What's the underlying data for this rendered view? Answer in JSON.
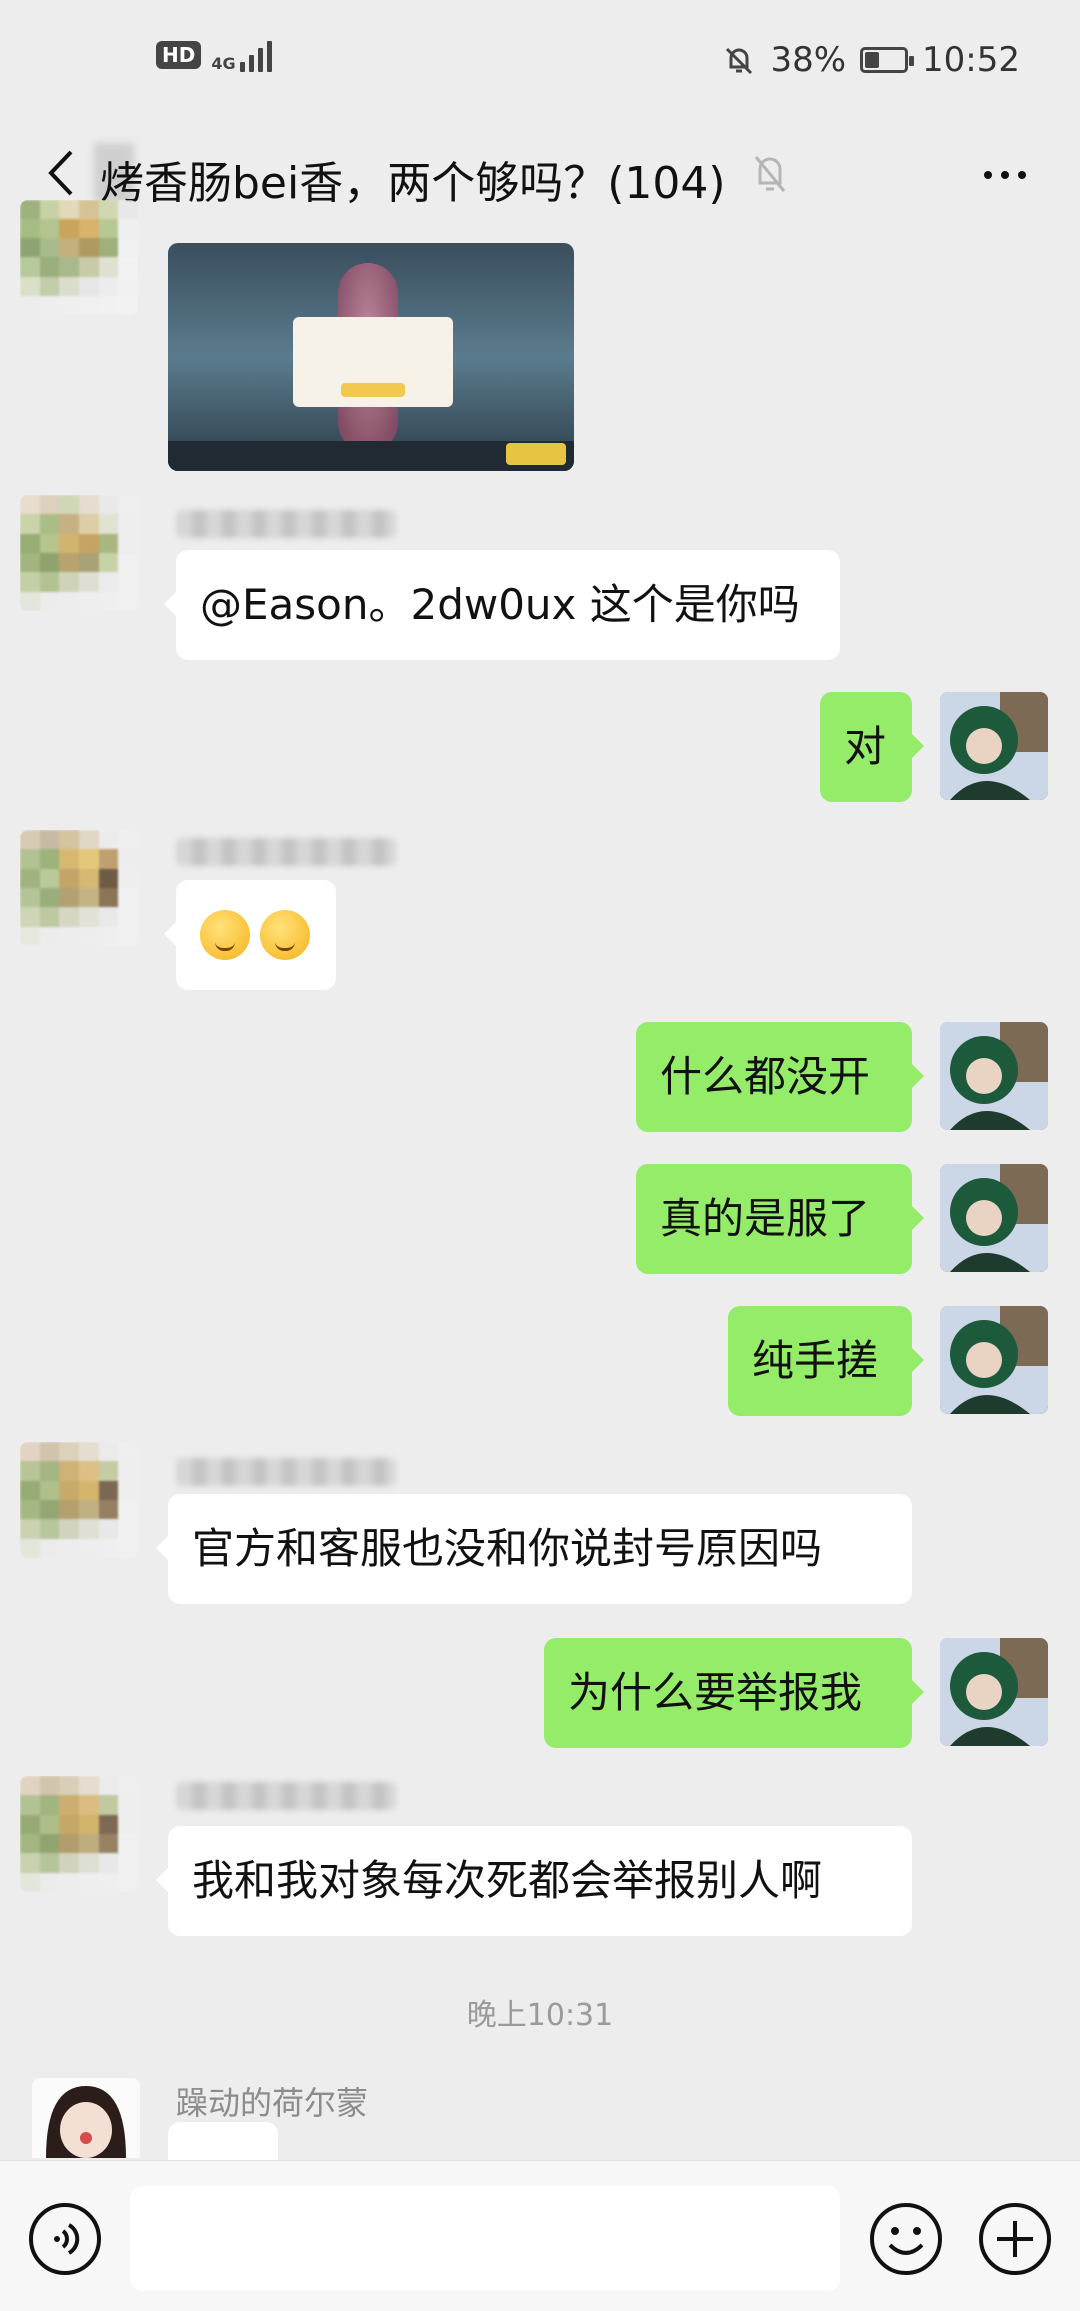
{
  "status": {
    "network": "4G",
    "hd": "HD",
    "battery": "38%",
    "battery_level": 0.38,
    "time": "10:52"
  },
  "header": {
    "title": "烤香肠bei香，两个够吗？(104)"
  },
  "messages": [
    {
      "text": "@Eason。2dw0ux  这个是你吗"
    },
    {
      "text": "对"
    },
    {
      "text": ""
    },
    {
      "text": "什么都没开"
    },
    {
      "text": "真的是服了"
    },
    {
      "text": "纯手搓"
    },
    {
      "text": "官方和客服也没和你说封号原因吗"
    },
    {
      "text": "为什么要举报我"
    },
    {
      "text": "我和我对象每次死都会举报别人啊"
    }
  ],
  "timestamp": "晚上10:31",
  "last_sender": "躁动的荷尔蒙",
  "colors": {
    "background": "#ededed",
    "my_bubble": "#95ec69",
    "other_bubble": "#ffffff"
  },
  "icons": {
    "back": "back-icon",
    "mute": "mute-bell-icon",
    "more": "more-icon",
    "voice": "voice-icon",
    "emoji": "emoji-icon",
    "plus": "plus-icon"
  }
}
